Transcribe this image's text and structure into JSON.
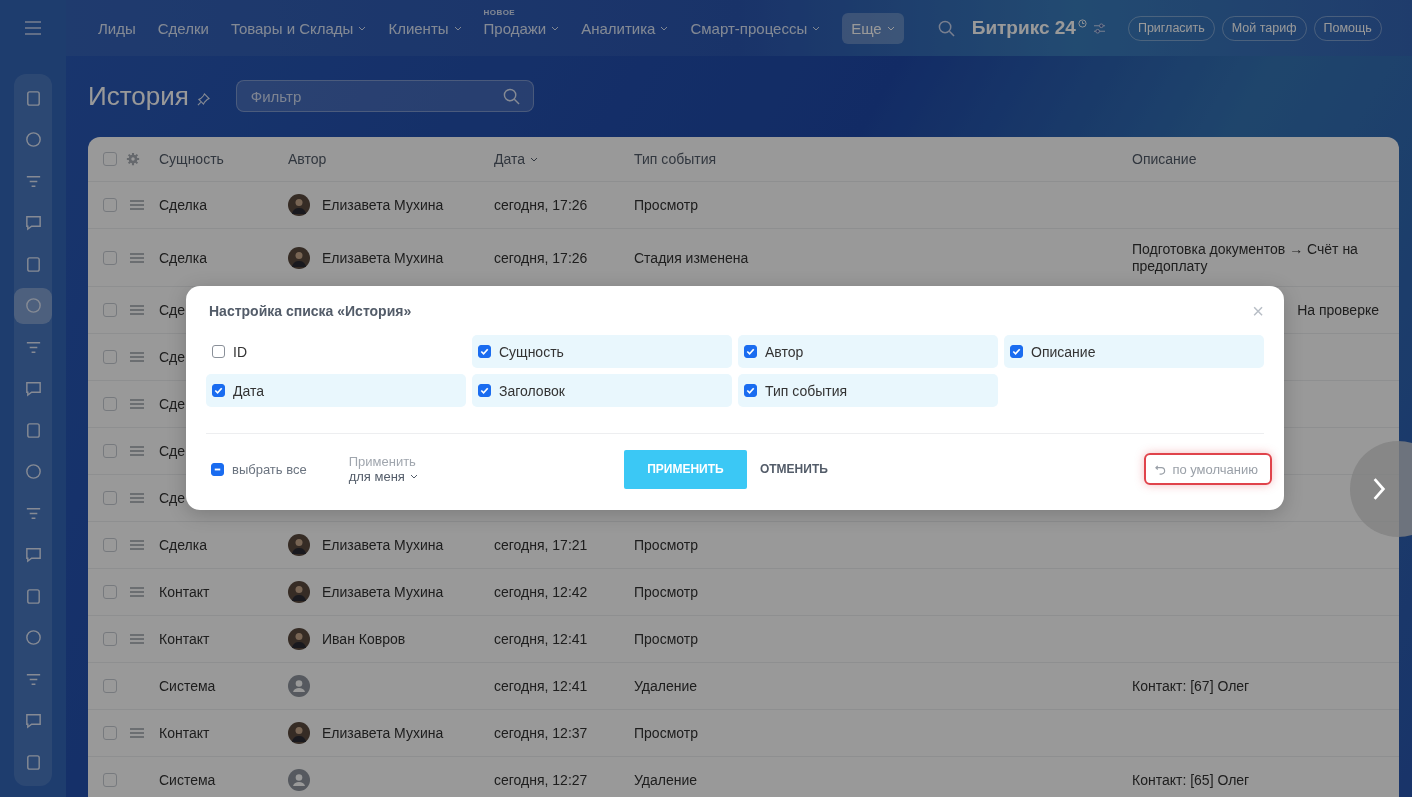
{
  "top_bar": {
    "nav": [
      {
        "label": "Лиды",
        "dropdown": false,
        "selected": false
      },
      {
        "label": "Сделки",
        "dropdown": false,
        "selected": false
      },
      {
        "label": "Товары и Склады",
        "dropdown": true,
        "selected": false
      },
      {
        "label": "Клиенты",
        "dropdown": true,
        "selected": false
      },
      {
        "label": "Продажи",
        "dropdown": true,
        "selected": false,
        "badge": "НОВОЕ"
      },
      {
        "label": "Аналитика",
        "dropdown": true,
        "selected": false
      },
      {
        "label": "Смарт-процессы",
        "dropdown": true,
        "selected": false
      },
      {
        "label": "Еще",
        "dropdown": true,
        "selected": true
      }
    ],
    "logo": "Битрикс 24",
    "buttons": [
      "Пригласить",
      "Мой тариф",
      "Помощь"
    ]
  },
  "sidebar": {
    "items": [
      {
        "selected": false
      },
      {
        "selected": false
      },
      {
        "selected": false
      },
      {
        "selected": false
      },
      {
        "selected": false
      },
      {
        "selected": true
      },
      {
        "selected": false
      },
      {
        "selected": false
      },
      {
        "selected": false
      },
      {
        "selected": false
      },
      {
        "selected": false
      },
      {
        "selected": false
      },
      {
        "selected": false
      },
      {
        "selected": false
      },
      {
        "selected": false
      },
      {
        "selected": false
      },
      {
        "selected": false
      }
    ]
  },
  "page": {
    "title": "История",
    "filter": {
      "placeholder": "Фильтр"
    }
  },
  "table": {
    "all_checked": false,
    "columns": [
      {
        "label": "Сущность",
        "sorted": false
      },
      {
        "label": "Автор",
        "sorted": false
      },
      {
        "label": "Дата",
        "sorted": true
      },
      {
        "label": "Тип события",
        "sorted": false
      },
      {
        "label": "Описание",
        "sorted": false
      }
    ],
    "rows": [
      {
        "checked": false,
        "entity": "Сделка",
        "handle": true,
        "author": "Елизавета Мухина",
        "date": "сегодня, 17:26",
        "type": "Просмотр"
      },
      {
        "checked": false,
        "entity": "Сделка",
        "handle": true,
        "author": "Елизавета Мухина",
        "date": "сегодня, 17:26",
        "type": "Стадия изменена",
        "description": "Подготовка документов → Счёт на предоплату"
      },
      {
        "checked": false,
        "entity": "Сде",
        "handle": true,
        "description": "На проверке"
      },
      {
        "checked": false,
        "entity": "Сде",
        "handle": true
      },
      {
        "checked": false,
        "entity": "Сде",
        "handle": true
      },
      {
        "checked": false,
        "entity": "Сде",
        "handle": true
      },
      {
        "checked": false,
        "entity": "Сде",
        "handle": true
      },
      {
        "checked": false,
        "entity": "Сделка",
        "handle": true,
        "author": "Елизавета Мухина",
        "date": "сегодня, 17:21",
        "type": "Просмотр"
      },
      {
        "checked": false,
        "entity": "Контакт",
        "handle": true,
        "author": "Елизавета Мухина",
        "date": "сегодня, 12:42",
        "type": "Просмотр"
      },
      {
        "checked": false,
        "entity": "Контакт",
        "handle": true,
        "author": "Иван Ковров",
        "date": "сегодня, 12:41",
        "type": "Просмотр"
      },
      {
        "checked": false,
        "entity": "Система",
        "handle": false,
        "date": "сегодня, 12:41",
        "type": "Удаление",
        "description": "Контакт: [67] Олег"
      },
      {
        "checked": false,
        "entity": "Контакт",
        "handle": true,
        "author": "Елизавета Мухина",
        "date": "сегодня, 12:37",
        "type": "Просмотр"
      },
      {
        "checked": false,
        "entity": "Система",
        "handle": false,
        "date": "сегодня, 12:27",
        "type": "Удаление",
        "description": "Контакт: [65] Олег"
      }
    ]
  },
  "dialog": {
    "title": "Настройка списка «История»",
    "close": "×",
    "options": [
      {
        "label": "ID",
        "checked": false
      },
      {
        "label": "Сущность",
        "checked": true
      },
      {
        "label": "Автор",
        "checked": true
      },
      {
        "label": "Описание",
        "checked": true
      },
      {
        "label": "Дата",
        "checked": true
      },
      {
        "label": "Заголовок",
        "checked": true
      },
      {
        "label": "Тип события",
        "checked": true
      }
    ],
    "select_all": {
      "label": "выбрать все",
      "indeterminate": true
    },
    "apply_for": {
      "label": "Применить",
      "value": "для меня"
    },
    "apply": "ПРИМЕНИТЬ",
    "cancel": "ОТМЕНИТЬ",
    "reset": {
      "label": "по умолчанию",
      "highlighted": true
    }
  }
}
